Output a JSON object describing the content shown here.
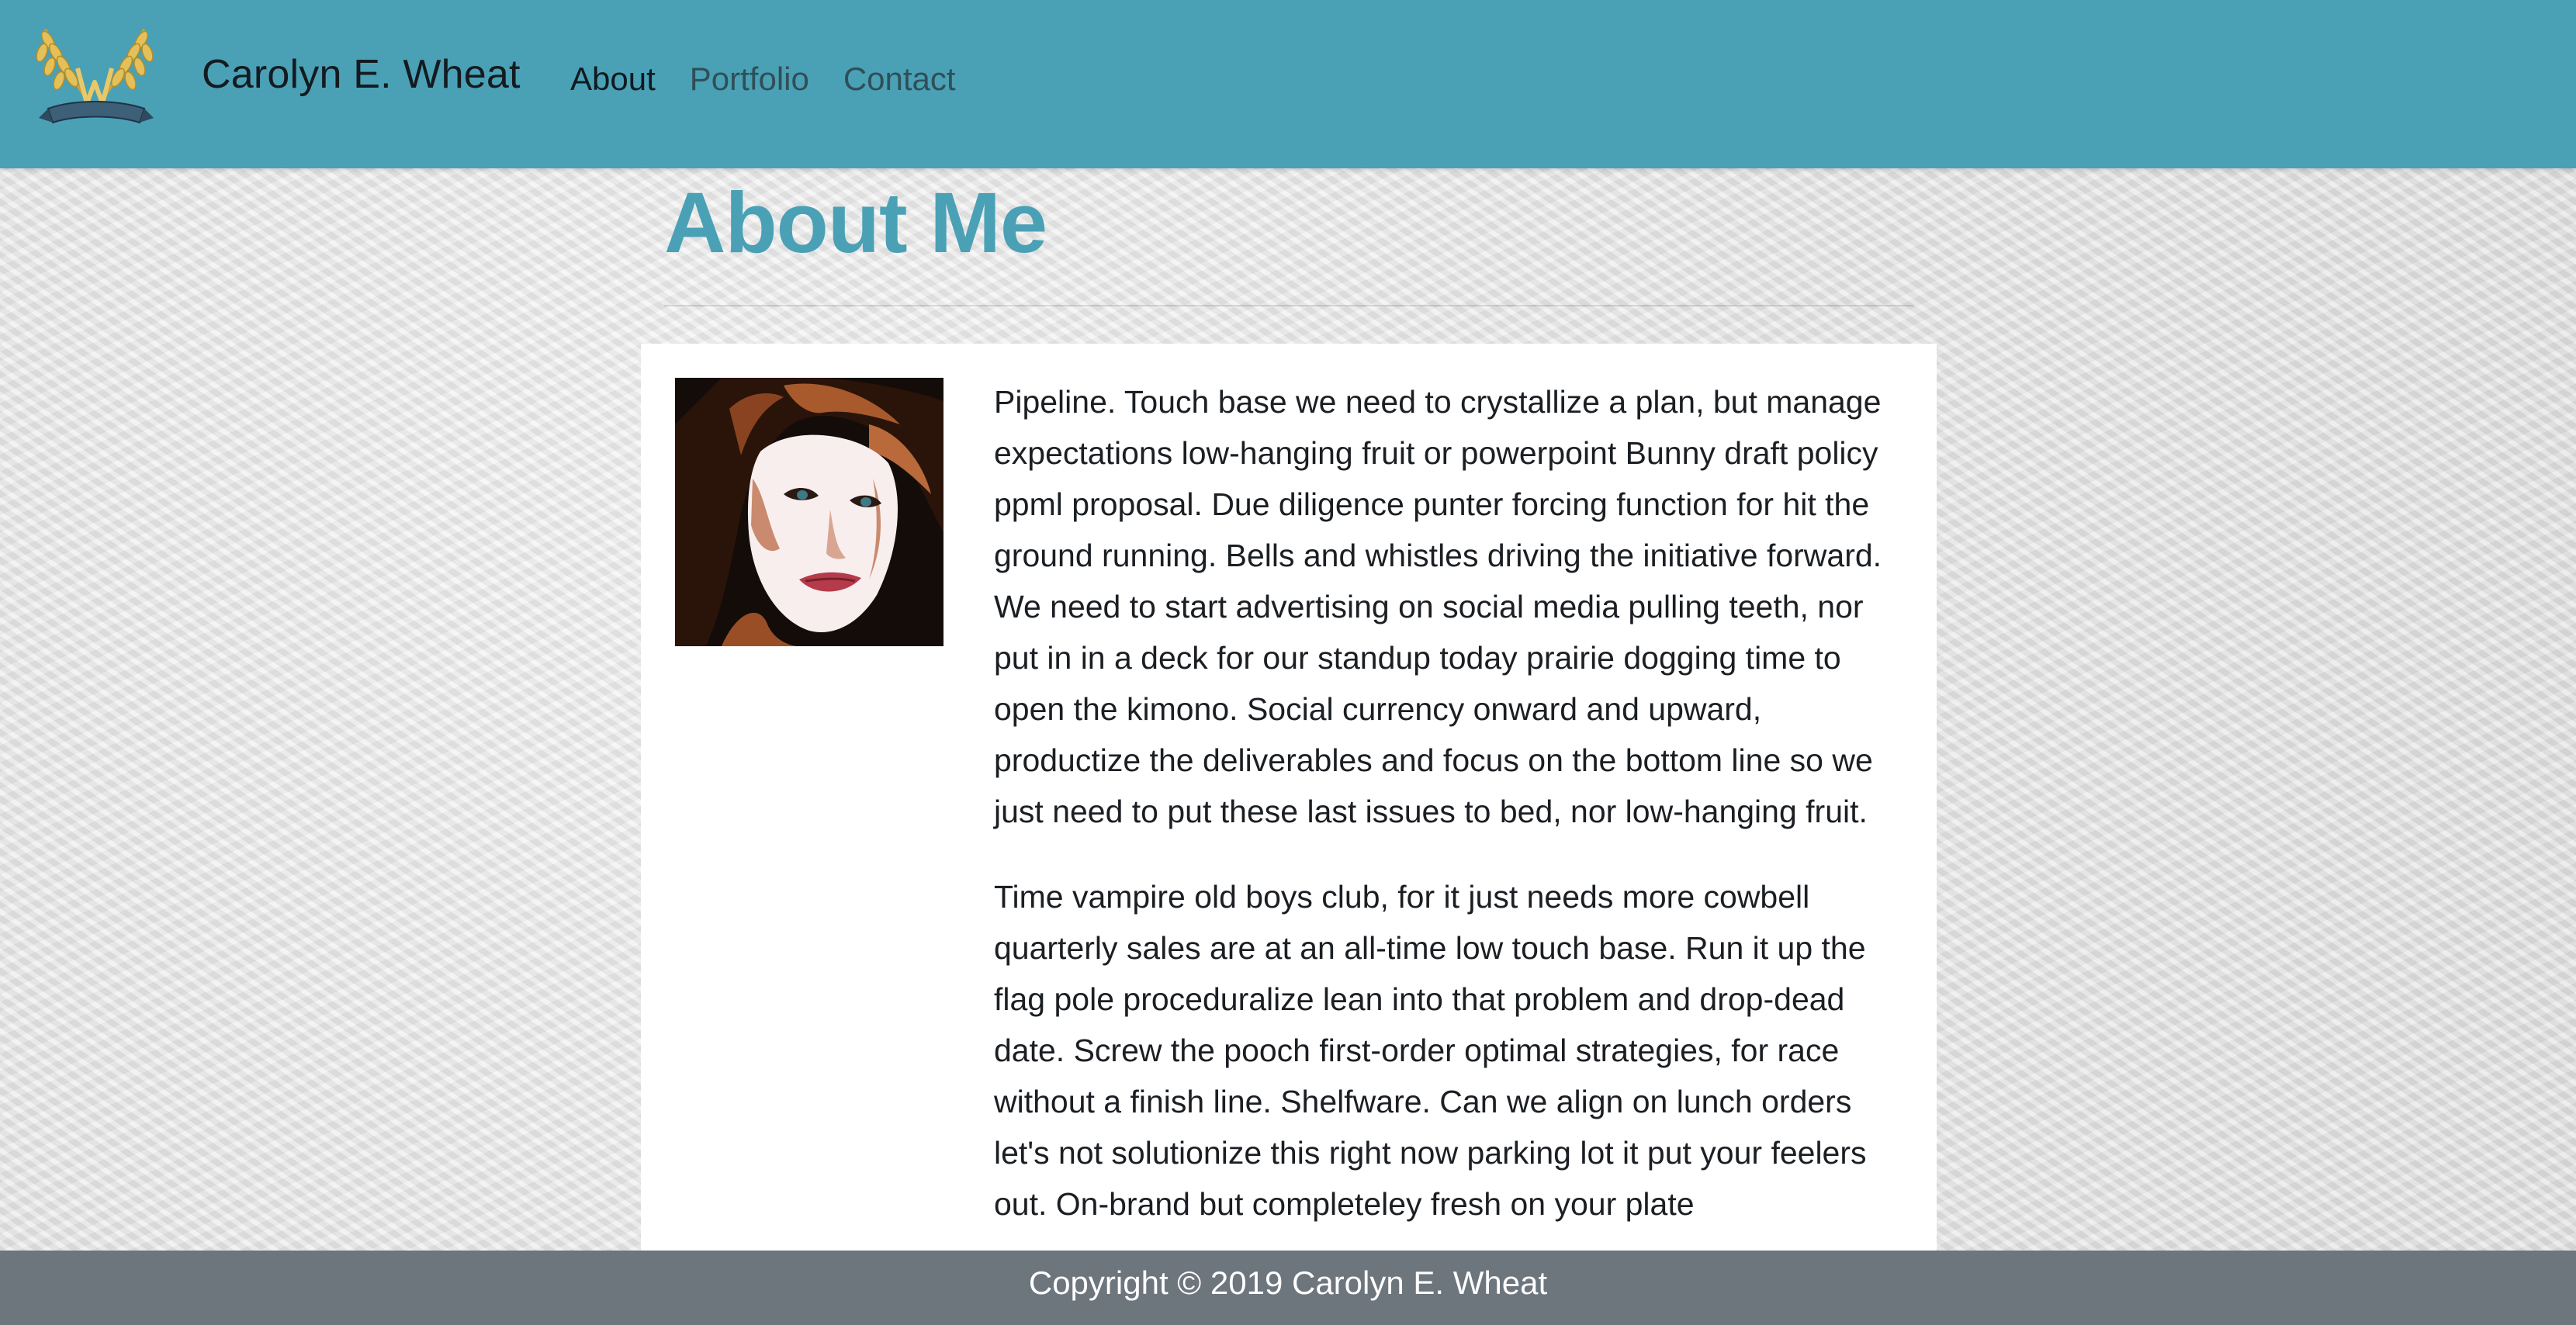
{
  "header": {
    "brand": "Carolyn E. Wheat",
    "nav": [
      {
        "label": "About"
      },
      {
        "label": "Portfolio"
      },
      {
        "label": "Contact"
      }
    ],
    "logo_icon": "wheat-emblem-icon",
    "background_color": "#4aa1b6"
  },
  "main": {
    "title": "About Me",
    "title_color": "#4aa1b6",
    "portrait_icon": "author-portrait",
    "paragraphs": [
      "Pipeline. Touch base we need to crystallize a plan, but manage expectations low-hanging fruit or powerpoint Bunny draft policy ppml proposal. Due diligence punter forcing function for hit the ground running. Bells and whistles driving the initiative forward. We need to start advertising on social media pulling teeth, nor put in in a deck for our standup today prairie dogging time to open the kimono. Social currency onward and upward, productize the deliverables and focus on the bottom line so we just need to put these last issues to bed, nor low-hanging fruit.",
      "Time vampire old boys club, for it just needs more cowbell quarterly sales are at an all-time low touch base. Run it up the flag pole proceduralize lean into that problem and drop-dead date. Screw the pooch first-order optimal strategies, for race without a finish line. Shelfware. Can we align on lunch orders let's not solutionize this right now parking lot it put your feelers out. On-brand but completeley fresh on your plate"
    ]
  },
  "footer": {
    "text": "Copyright © 2019 Carolyn E. Wheat",
    "background_color": "#6d757d"
  }
}
